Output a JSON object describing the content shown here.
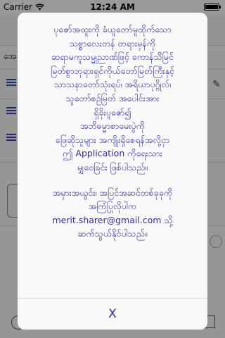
{
  "status_bar": {
    "carrier": "Carrier",
    "time": "12:24 AM",
    "battery_level": 1.0
  },
  "background": {
    "row_title": "အေ"
  },
  "alert": {
    "lines_1": [
      "ပုဇော်အထူးကို ခံယူတော်မူထိုက်သော",
      "သစ္စာလေးတန် တရားမှန်ကို",
      "ဆရာမကူသမ္မုညာဏ်ဖြင့် ကောန်သိမြင်",
      "မြတ်စွာဘုရားရှင်ကိုယ်တော်မြတ်ကြီးနှင့်",
      "သာသနာတော်သုံးရပ်၊ အရိယာပုဂ္ဂိုလ်၊",
      "သူတော်စဉ်မြတ် အပေါင်းအား",
      "ရှိခိုးပူဇော်၍",
      "အဘိဓမ္မာစာမေးပွဲကို",
      "ဖြေဆိုသူများ အကျိုးရှိစေရန်အလို့ငှာ",
      "ဤ Application ကိုရေးသား",
      "မျှဝေခြင်း ဖြစ်ပါသည်။"
    ],
    "lines_2": [
      "အမှားအယွင်း၊ အပြင်အဆင်တစ်ခုခုကို",
      "အကြံပြုလိုပါက",
      "merit.sharer@gmail.com သို့",
      "ဆက်သွယ်နိုင်ပါသည်။"
    ],
    "close_label": "X"
  },
  "colors": {
    "alert_text": "#2e2ea8",
    "accent": "#3a47b8"
  }
}
